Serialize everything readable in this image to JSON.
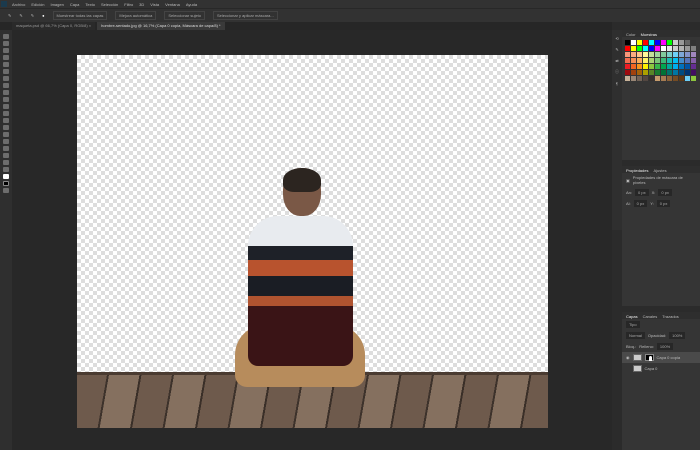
{
  "app": {
    "logo": "Ps"
  },
  "menu": [
    "Archivo",
    "Edición",
    "Imagen",
    "Capa",
    "Texto",
    "Selección",
    "Filtro",
    "3D",
    "Vista",
    "Ventana",
    "Ayuda"
  ],
  "options": {
    "buttons": [
      "Muestrear todas las capas",
      "Mejora automática",
      "Seleccionar sujeto",
      "Seleccionar y aplicar máscara..."
    ]
  },
  "tabs": [
    {
      "label": "maqueta.psd @ 66,7% (Capa 0, RGB/8) ×",
      "active": false
    },
    {
      "label": "hombre-sentado.jpg @ 16,7% (Capa 0 copia, Máscara de capa/8) *",
      "active": true
    }
  ],
  "panels": {
    "swatches": {
      "tabs": [
        "Color",
        "Muestras"
      ],
      "active": 1,
      "colors": [
        "#000000",
        "#ffffff",
        "#ffff00",
        "#ff0000",
        "#00ffff",
        "#0000ff",
        "#ff00ff",
        "#00ff00",
        "#cccccc",
        "#999999",
        "#666666",
        "#333333",
        "#ff0000",
        "#ffff00",
        "#00ff00",
        "#00ffff",
        "#0000ff",
        "#ff00ff",
        "#ffffff",
        "#e6e6e6",
        "#cccccc",
        "#b3b3b3",
        "#999999",
        "#808080",
        "#f7977a",
        "#f9ad81",
        "#fdc68a",
        "#fff79a",
        "#c4df9b",
        "#a2d39c",
        "#82ca9d",
        "#7bcdc8",
        "#6ecff6",
        "#7ea7d8",
        "#8493ca",
        "#a187be",
        "#f26c4f",
        "#f68e55",
        "#fbaf5c",
        "#fff467",
        "#acd372",
        "#7cc576",
        "#3bb878",
        "#1abbb4",
        "#00bff3",
        "#438ccb",
        "#5574b9",
        "#855fa8",
        "#ed1c24",
        "#f26522",
        "#f7941d",
        "#fff200",
        "#8dc73f",
        "#39b54a",
        "#00a651",
        "#00a99d",
        "#00aeef",
        "#0072bc",
        "#0054a6",
        "#662d91",
        "#9e0b0f",
        "#a0410d",
        "#a36209",
        "#aba000",
        "#598527",
        "#1a7b30",
        "#007236",
        "#00746b",
        "#0076a3",
        "#004b80",
        "#003471",
        "#440e62",
        "#c7b299",
        "#998675",
        "#736357",
        "#534741",
        "#37302d",
        "#c69c6d",
        "#a67c52",
        "#8c6239",
        "#754c24",
        "#603913",
        "#6dcff6",
        "#8dc63f"
      ]
    },
    "properties": {
      "tabs": [
        "Propiedades",
        "Ajustes"
      ],
      "active": 0,
      "title": "Propiedades de máscara de píxeles",
      "fields": [
        {
          "label": "An:",
          "value": "0 px"
        },
        {
          "label": "X:",
          "value": "0 px"
        },
        {
          "label": "Al:",
          "value": "0 px"
        },
        {
          "label": "Y:",
          "value": "0 px"
        }
      ]
    },
    "layers": {
      "tabs": [
        "Capas",
        "Canales",
        "Trazados"
      ],
      "active": 0,
      "filter": "Tipo",
      "mode": "Normal",
      "opacity_label": "Opacidad:",
      "opacity": "100%",
      "lock_label": "Bloq.:",
      "fill_label": "Relleno:",
      "fill": "100%",
      "items": [
        {
          "name": "Capa 0 copia",
          "selected": true,
          "mask": true
        },
        {
          "name": "Capa 0",
          "selected": false,
          "mask": false
        }
      ]
    }
  }
}
